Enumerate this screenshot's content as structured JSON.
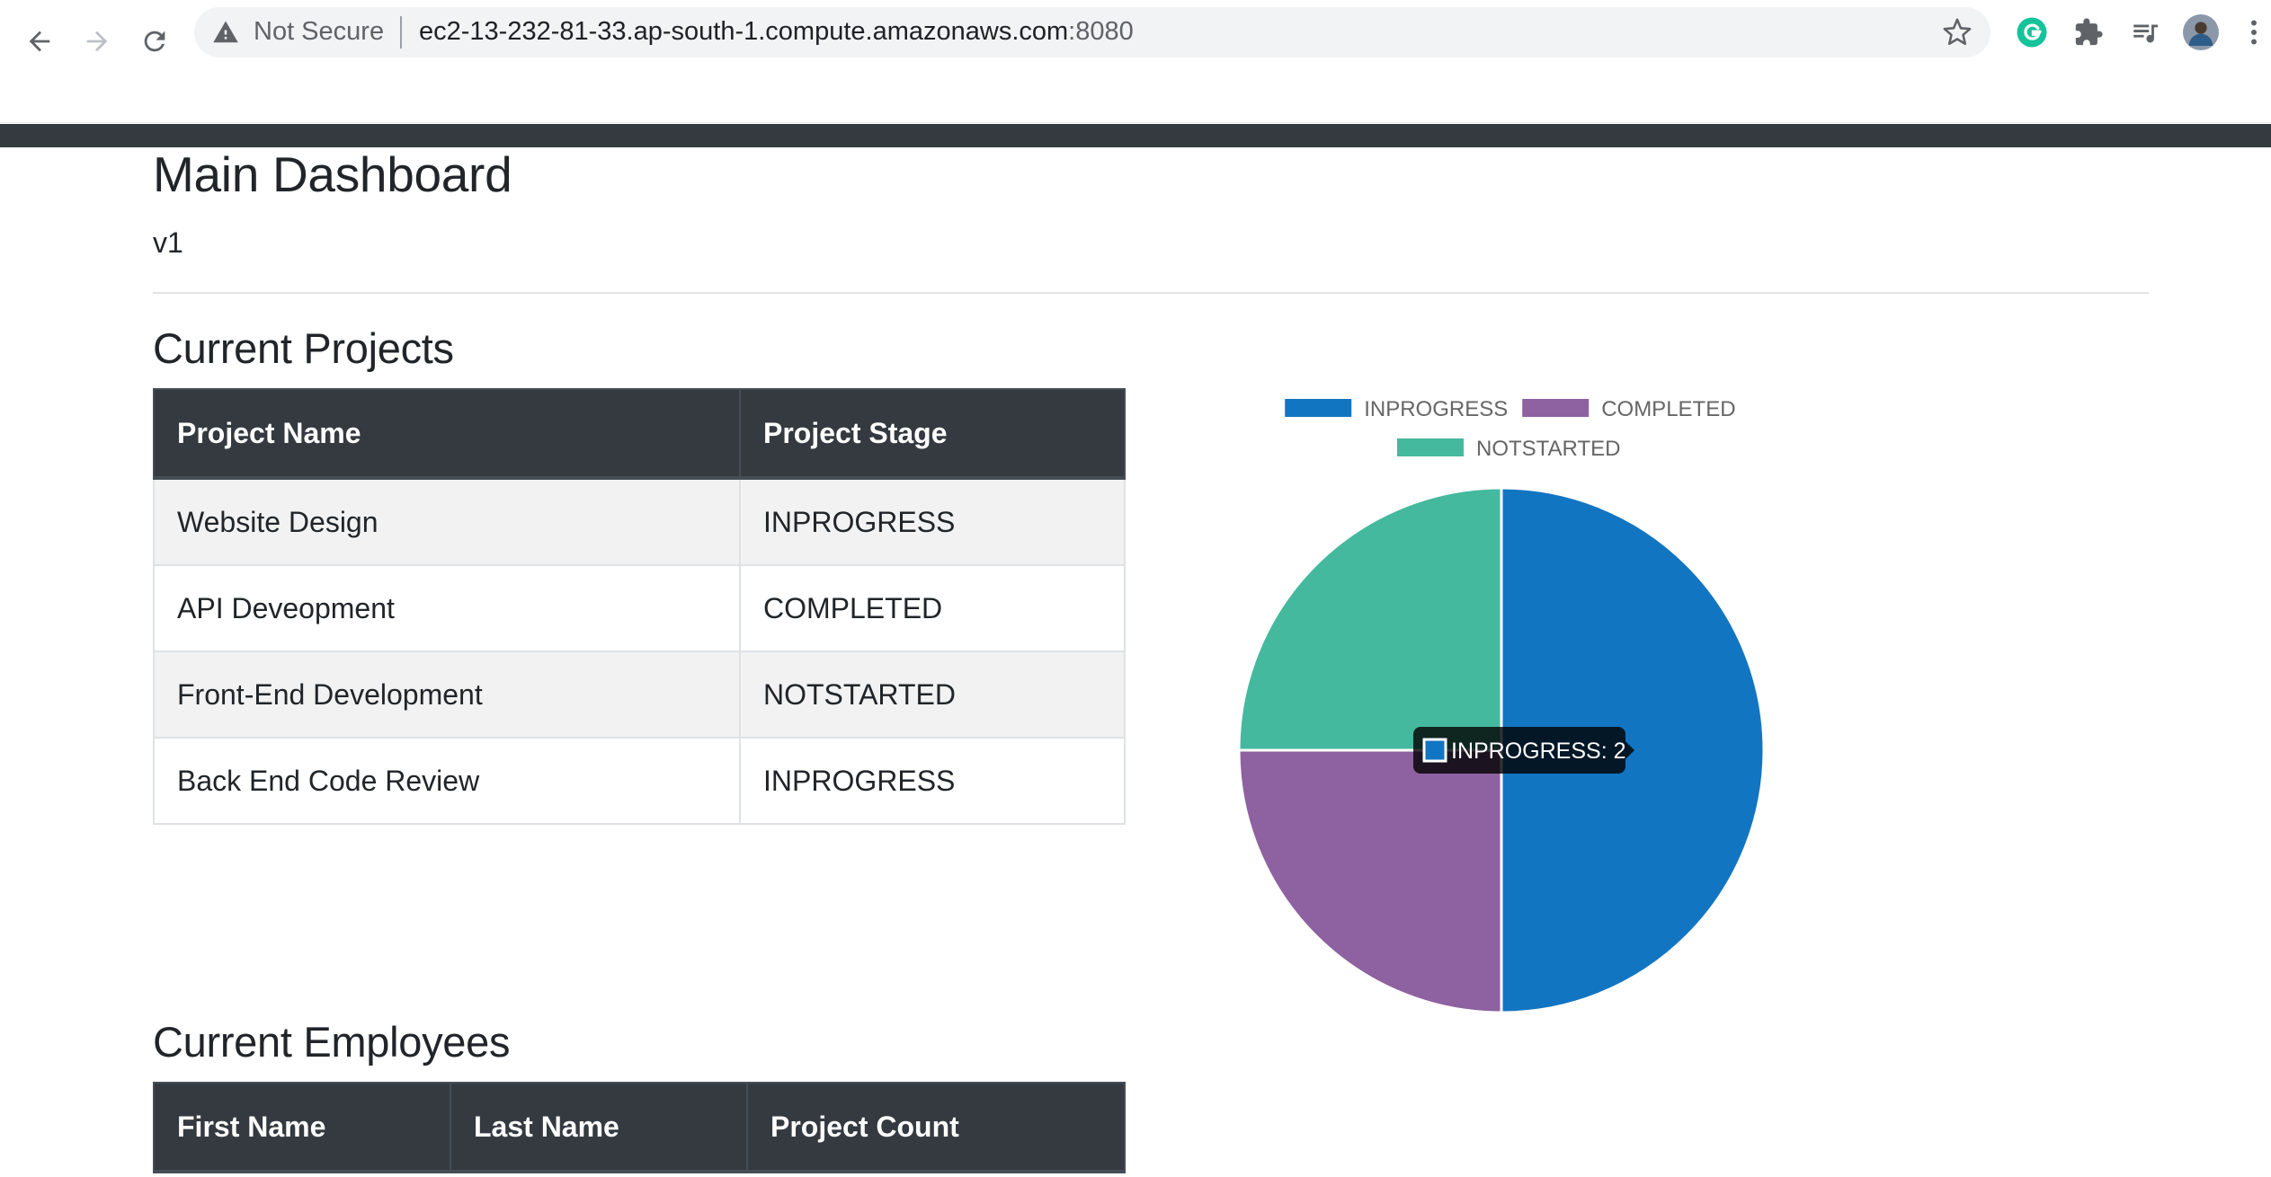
{
  "browser": {
    "security_label": "Not Secure",
    "url_host": "ec2-13-232-81-33.ap-south-1.compute.amazonaws.com",
    "url_port": ":8080"
  },
  "page": {
    "title": "Main Dashboard",
    "version": "v1"
  },
  "projects": {
    "heading": "Current Projects",
    "columns": [
      "Project Name",
      "Project Stage"
    ],
    "rows": [
      [
        "Website Design",
        "INPROGRESS"
      ],
      [
        "API Deveopment",
        "COMPLETED"
      ],
      [
        "Front-End Development",
        "NOTSTARTED"
      ],
      [
        "Back End Code Review",
        "INPROGRESS"
      ]
    ]
  },
  "employees": {
    "heading": "Current Employees",
    "columns": [
      "First Name",
      "Last Name",
      "Project Count"
    ]
  },
  "chart_data": {
    "type": "pie",
    "categories": [
      "INPROGRESS",
      "COMPLETED",
      "NOTSTARTED"
    ],
    "values": [
      2,
      1,
      1
    ],
    "colors": [
      "#1275c2",
      "#8e61a0",
      "#45b99e"
    ],
    "legend_position": "top",
    "tooltip": "INPROGRESS: 2"
  },
  "colors": {
    "navbar": "#343a40",
    "table_header": "#343a40",
    "grammarly": "#15c39a"
  }
}
